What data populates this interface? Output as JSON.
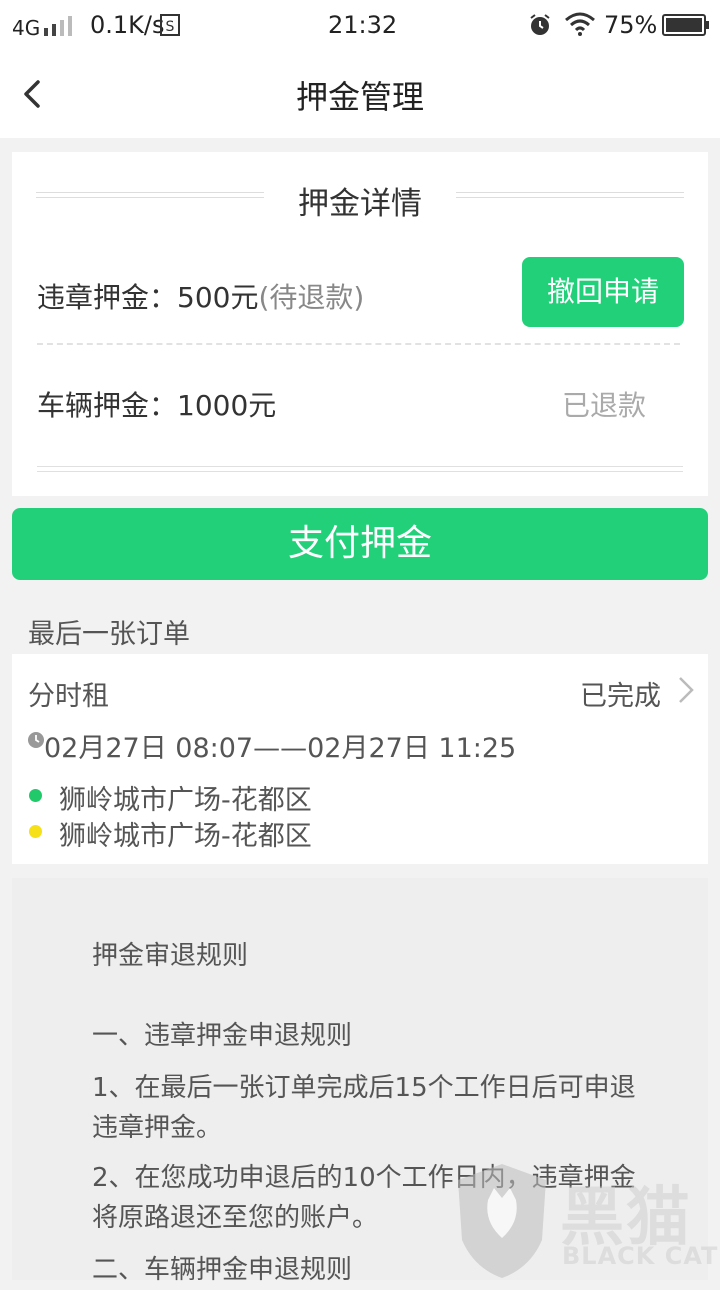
{
  "status_bar": {
    "network": "4G",
    "speed": "0.1K/s",
    "time": "21:32",
    "battery": "75%"
  },
  "nav": {
    "title": "押金管理"
  },
  "deposit": {
    "section_title": "押金详情",
    "violation": {
      "label": "违章押金：500元",
      "status": "(待退款)",
      "action": "撤回申请"
    },
    "vehicle": {
      "label": "车辆押金：1000元",
      "status": "已退款"
    }
  },
  "pay_button": "支付押金",
  "last_order": {
    "label": "最后一张订单",
    "type": "分时租",
    "status": "已完成",
    "time": "02月27日 08:07——02月27日 11:25",
    "start": "狮岭城市广场-花都区",
    "end": "狮岭城市广场-花都区"
  },
  "rules": {
    "title": "押金审退规则",
    "s1": "一、违章押金申退规则",
    "s1_p1": "1、在最后一张订单完成后15个工作日后可申退违章押金。",
    "s1_p2": "2、在您成功申退后的10个工作日内，违章押金将原路退还至您的账户。",
    "s2": "二、车辆押金申退规则"
  },
  "watermark": {
    "cn": "黑猫",
    "en": "BLACK CAT"
  },
  "colors": {
    "accent": "#22d07a",
    "start_dot": "#22c96b",
    "end_dot": "#f5e01a"
  },
  "icons": [
    "back-arrow-icon",
    "chevron-right-icon",
    "clock-icon",
    "alarm-icon",
    "wifi-icon",
    "battery-icon",
    "signal-icon",
    "sim-icon"
  ]
}
